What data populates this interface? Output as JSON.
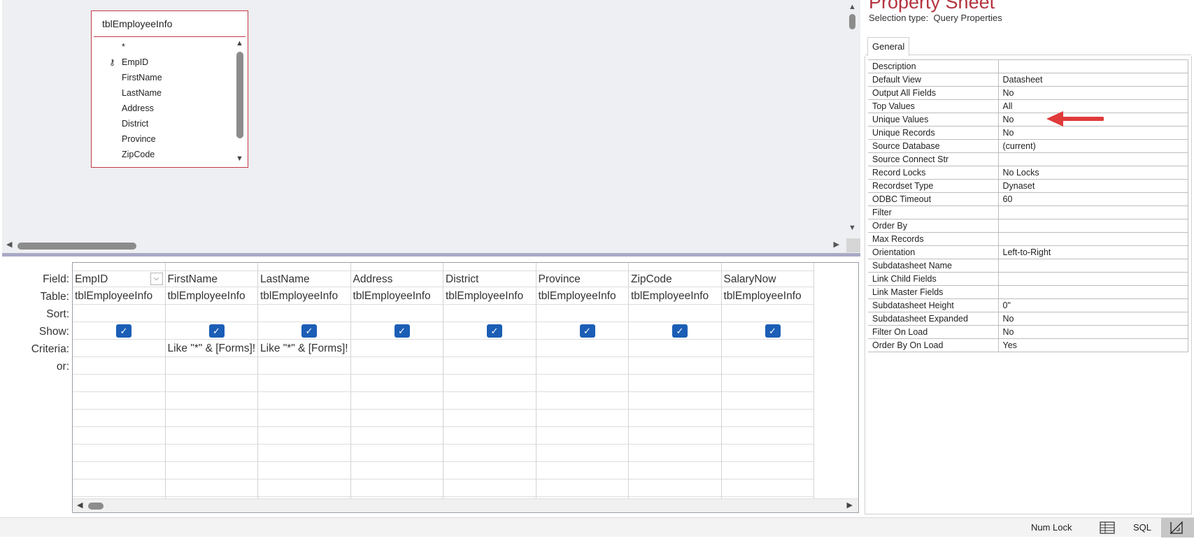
{
  "table_box": {
    "title": "tblEmployeeInfo",
    "fields": [
      "*",
      "EmpID",
      "FirstName",
      "LastName",
      "Address",
      "District",
      "Province",
      "ZipCode"
    ],
    "key_field": "EmpID"
  },
  "grid": {
    "row_labels": [
      "Field:",
      "Table:",
      "Sort:",
      "Show:",
      "Criteria:",
      "or:"
    ],
    "columns": [
      {
        "field": "EmpID",
        "table": "tblEmployeeInfo",
        "sort": "",
        "show": true,
        "criteria": "",
        "or": ""
      },
      {
        "field": "FirstName",
        "table": "tblEmployeeInfo",
        "sort": "",
        "show": true,
        "criteria": "Like \"*\" & [Forms]!",
        "or": ""
      },
      {
        "field": "LastName",
        "table": "tblEmployeeInfo",
        "sort": "",
        "show": true,
        "criteria": "Like \"*\" & [Forms]!",
        "or": ""
      },
      {
        "field": "Address",
        "table": "tblEmployeeInfo",
        "sort": "",
        "show": true,
        "criteria": "",
        "or": ""
      },
      {
        "field": "District",
        "table": "tblEmployeeInfo",
        "sort": "",
        "show": true,
        "criteria": "",
        "or": ""
      },
      {
        "field": "Province",
        "table": "tblEmployeeInfo",
        "sort": "",
        "show": true,
        "criteria": "",
        "or": ""
      },
      {
        "field": "ZipCode",
        "table": "tblEmployeeInfo",
        "sort": "",
        "show": true,
        "criteria": "",
        "or": ""
      },
      {
        "field": "SalaryNow",
        "table": "tblEmployeeInfo",
        "sort": "",
        "show": true,
        "criteria": "",
        "or": ""
      }
    ],
    "empty_rows": 7
  },
  "property_sheet": {
    "title": "Property Sheet",
    "selection_label": "Selection type:",
    "selection_value": "Query Properties",
    "tab": "General",
    "properties": [
      {
        "name": "Description",
        "value": ""
      },
      {
        "name": "Default View",
        "value": "Datasheet"
      },
      {
        "name": "Output All Fields",
        "value": "No"
      },
      {
        "name": "Top Values",
        "value": "All"
      },
      {
        "name": "Unique Values",
        "value": "No"
      },
      {
        "name": "Unique Records",
        "value": "No"
      },
      {
        "name": "Source Database",
        "value": "(current)"
      },
      {
        "name": "Source Connect Str",
        "value": ""
      },
      {
        "name": "Record Locks",
        "value": "No Locks"
      },
      {
        "name": "Recordset Type",
        "value": "Dynaset"
      },
      {
        "name": "ODBC Timeout",
        "value": "60"
      },
      {
        "name": "Filter",
        "value": ""
      },
      {
        "name": "Order By",
        "value": ""
      },
      {
        "name": "Max Records",
        "value": ""
      },
      {
        "name": "Orientation",
        "value": "Left-to-Right"
      },
      {
        "name": "Subdatasheet Name",
        "value": ""
      },
      {
        "name": "Link Child Fields",
        "value": ""
      },
      {
        "name": "Link Master Fields",
        "value": ""
      },
      {
        "name": "Subdatasheet Height",
        "value": "0\""
      },
      {
        "name": "Subdatasheet Expanded",
        "value": "No"
      },
      {
        "name": "Filter On Load",
        "value": "No"
      },
      {
        "name": "Order By On Load",
        "value": "Yes"
      }
    ],
    "highlighted_property": "Unique Values",
    "arrow_color": "#e03a3a"
  },
  "status_bar": {
    "num_lock": "Num Lock",
    "datasheet_view_icon": "datasheet-view-icon",
    "sql_label": "SQL",
    "design_view_icon": "design-view-icon"
  },
  "colors": {
    "title_red": "#b2343f",
    "checkbox_blue": "#1b5eb5",
    "table_border": "#c43a46",
    "splitter": "#a9a9c6"
  }
}
